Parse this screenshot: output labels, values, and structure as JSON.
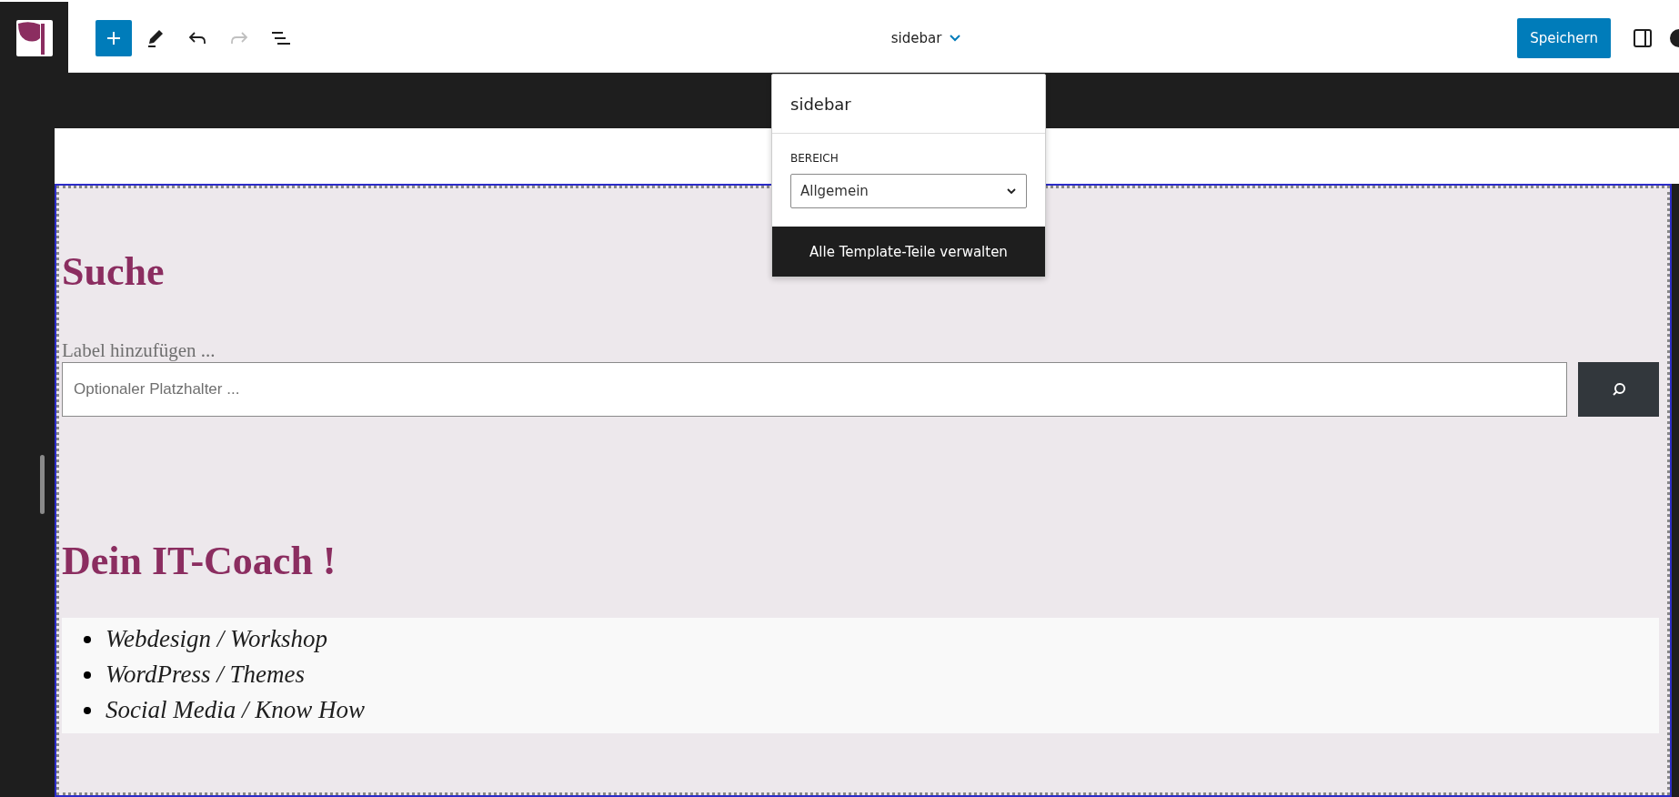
{
  "toolbar": {
    "tools": [
      {
        "kind": "inserter",
        "disabled": false
      },
      {
        "kind": "tools",
        "disabled": false
      },
      {
        "kind": "undo",
        "disabled": false
      },
      {
        "kind": "redo",
        "disabled": true
      },
      {
        "kind": "list_view",
        "disabled": false
      }
    ]
  },
  "document_title": "sidebar",
  "save_button": "Speichern",
  "popover": {
    "title": "sidebar",
    "area_label": "BEREICH",
    "area_value": "Allgemein",
    "manage_button": "Alle Template-Teile verwalten"
  },
  "canvas": {
    "blocks": [
      {
        "kind": "heading",
        "text": "Suche"
      },
      {
        "kind": "search",
        "label": "Label hinzufügen ...",
        "placeholder": "Optionaler Platzhalter ..."
      },
      {
        "kind": "heading",
        "text": "Dein IT-Coach !"
      },
      {
        "kind": "list",
        "items": [
          "Webdesign / Workshop",
          "WordPress / Themes",
          "Social Media / Know How"
        ]
      }
    ]
  }
}
